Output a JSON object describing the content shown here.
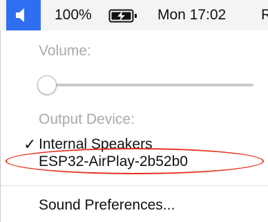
{
  "menubar": {
    "sound_icon": "speaker-icon",
    "battery_percent": "100%",
    "battery_icon": "battery-charging-icon",
    "clock": "Mon 17:02",
    "next_item": "R",
    "accent": "#2f6ef0"
  },
  "menu": {
    "volume_label": "Volume:",
    "volume_level_percent": 0,
    "output_device_label": "Output Device:",
    "devices": [
      {
        "label": "Internal Speakers",
        "selected": true
      },
      {
        "label": "ESP32-AirPlay-2b52b0",
        "selected": false
      }
    ],
    "preferences_label": "Sound Preferences...",
    "annotation_color": "#e6321e"
  }
}
